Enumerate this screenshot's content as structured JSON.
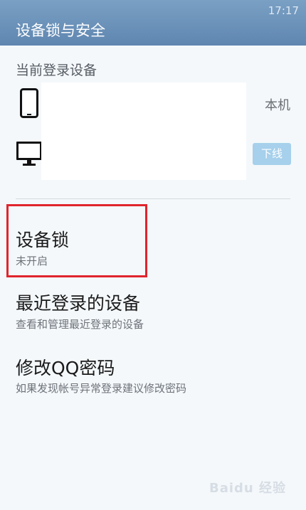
{
  "status_bar": {
    "time": "17:17"
  },
  "header": {
    "title": "设备锁与安全"
  },
  "current_devices": {
    "section_title": "当前登录设备",
    "devices": [
      {
        "icon": "phone-icon",
        "tag": "本机"
      },
      {
        "icon": "monitor-icon",
        "button_label": "下线"
      }
    ]
  },
  "menu": [
    {
      "title": "设备锁",
      "subtitle": "未开启"
    },
    {
      "title": "最近登录的设备",
      "subtitle": "查看和管理最近登录的设备"
    },
    {
      "title": "修改QQ密码",
      "subtitle": "如果发现帐号异常登录建议修改密码"
    }
  ],
  "annotation": {
    "highlight_color": "#e0242c"
  },
  "watermark": {
    "text": "Baidu 经验"
  },
  "colors": {
    "header": "#6a90b8",
    "offline_button": "#a6d0ec"
  }
}
